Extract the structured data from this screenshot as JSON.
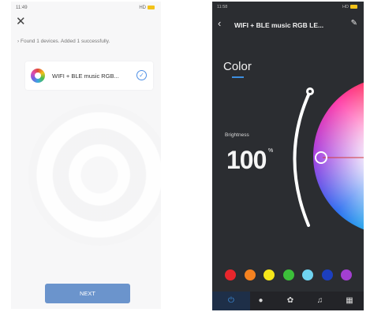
{
  "left": {
    "status": {
      "time": "11:49",
      "signal": "3d",
      "right": "HD"
    },
    "found_message": "Found 1 devices. Added 1 successfully.",
    "device": {
      "name": "WIFI + BLE music RGB..."
    },
    "next_label": "NEXT",
    "colors": {
      "accent": "#6b94cc",
      "check": "#4d8fe6"
    }
  },
  "right": {
    "status": {
      "time": "11:58",
      "right": "HD"
    },
    "title": "WIFI + BLE music RGB LE...",
    "tab_color": "Color",
    "brightness_label": "Brightness",
    "brightness_value": "100",
    "brightness_unit": "%",
    "swatches": [
      "#e8262c",
      "#f58220",
      "#f5e61a",
      "#3cbf3a",
      "#6fd3f0",
      "#1c3fbf",
      "#a33fd0"
    ],
    "nav": [
      {
        "name": "power-icon",
        "glyph": "⏻"
      },
      {
        "name": "bulb-icon",
        "glyph": "●"
      },
      {
        "name": "palette-icon",
        "glyph": "✿"
      },
      {
        "name": "music-icon",
        "glyph": "♫"
      },
      {
        "name": "grid-icon",
        "glyph": "▦"
      }
    ],
    "colors": {
      "background": "#2b2d31",
      "accent": "#3d8fe0"
    }
  }
}
